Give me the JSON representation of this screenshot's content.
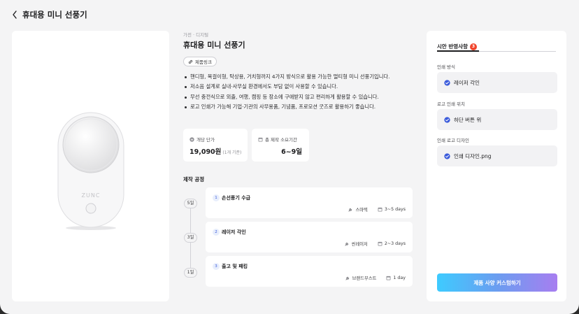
{
  "header": {
    "title": "휴대용 미니 선풍기",
    "back_icon": "chevron-left-icon"
  },
  "product": {
    "category": "가전 · 디지털",
    "title": "휴대용 미니 선풍기",
    "link_label": "제품링크",
    "features": [
      "핸디형, 목걸이형, 탁상용, 거치형까지 4가지 방식으로 활용 가능한 멀티형 미니 선풍기입니다.",
      "저소음 설계로 실내·사무실 환경에서도 부담 없이 사용할 수 있습니다.",
      "무선 충전식으로 외출, 여행, 캠핑 등 장소에 구애받지 않고 편리하게 활용할 수 있습니다.",
      "로고 인쇄가 가능해 기업·기관의 사무용품, 기념품, 프로모션 굿즈로 활용하기 좋습니다."
    ],
    "device_brand": "ZUNC"
  },
  "stats": {
    "price_label": "개당 단가",
    "price_value": "19,090원",
    "price_unit": "(1개 기준)",
    "period_label": "총 제작 소요기간",
    "period_value": "6~9일"
  },
  "process": {
    "title": "제작 공정",
    "steps": [
      {
        "day": "5일",
        "num": "1",
        "name": "손선풍기 수급",
        "vendor": "스마텍",
        "duration": "3~5 days"
      },
      {
        "day": "3일",
        "num": "2",
        "name": "레이저 각인",
        "vendor": "씬레이저",
        "duration": "2~3 days"
      },
      {
        "day": "1일",
        "num": "3",
        "name": "출고 및 패킹",
        "vendor": "브랜드부스트",
        "duration": "1 day"
      }
    ]
  },
  "side_panel": {
    "tab_label": "시안 반영사항",
    "tab_badge": "3",
    "fields": [
      {
        "label": "인쇄 방식",
        "value": "레이저 각인"
      },
      {
        "label": "로고 인쇄 위치",
        "value": "하단 버튼 위"
      },
      {
        "label": "인쇄 로고 디자인",
        "value": "인쇄 디자인.png"
      }
    ],
    "cta_label": "제품 사양 커스텀하기"
  },
  "colors": {
    "accent_blue": "#3b5bdb",
    "badge_red": "#f0452d",
    "cta_gradient_start": "#3ecbff",
    "cta_gradient_end": "#a77ef0"
  }
}
